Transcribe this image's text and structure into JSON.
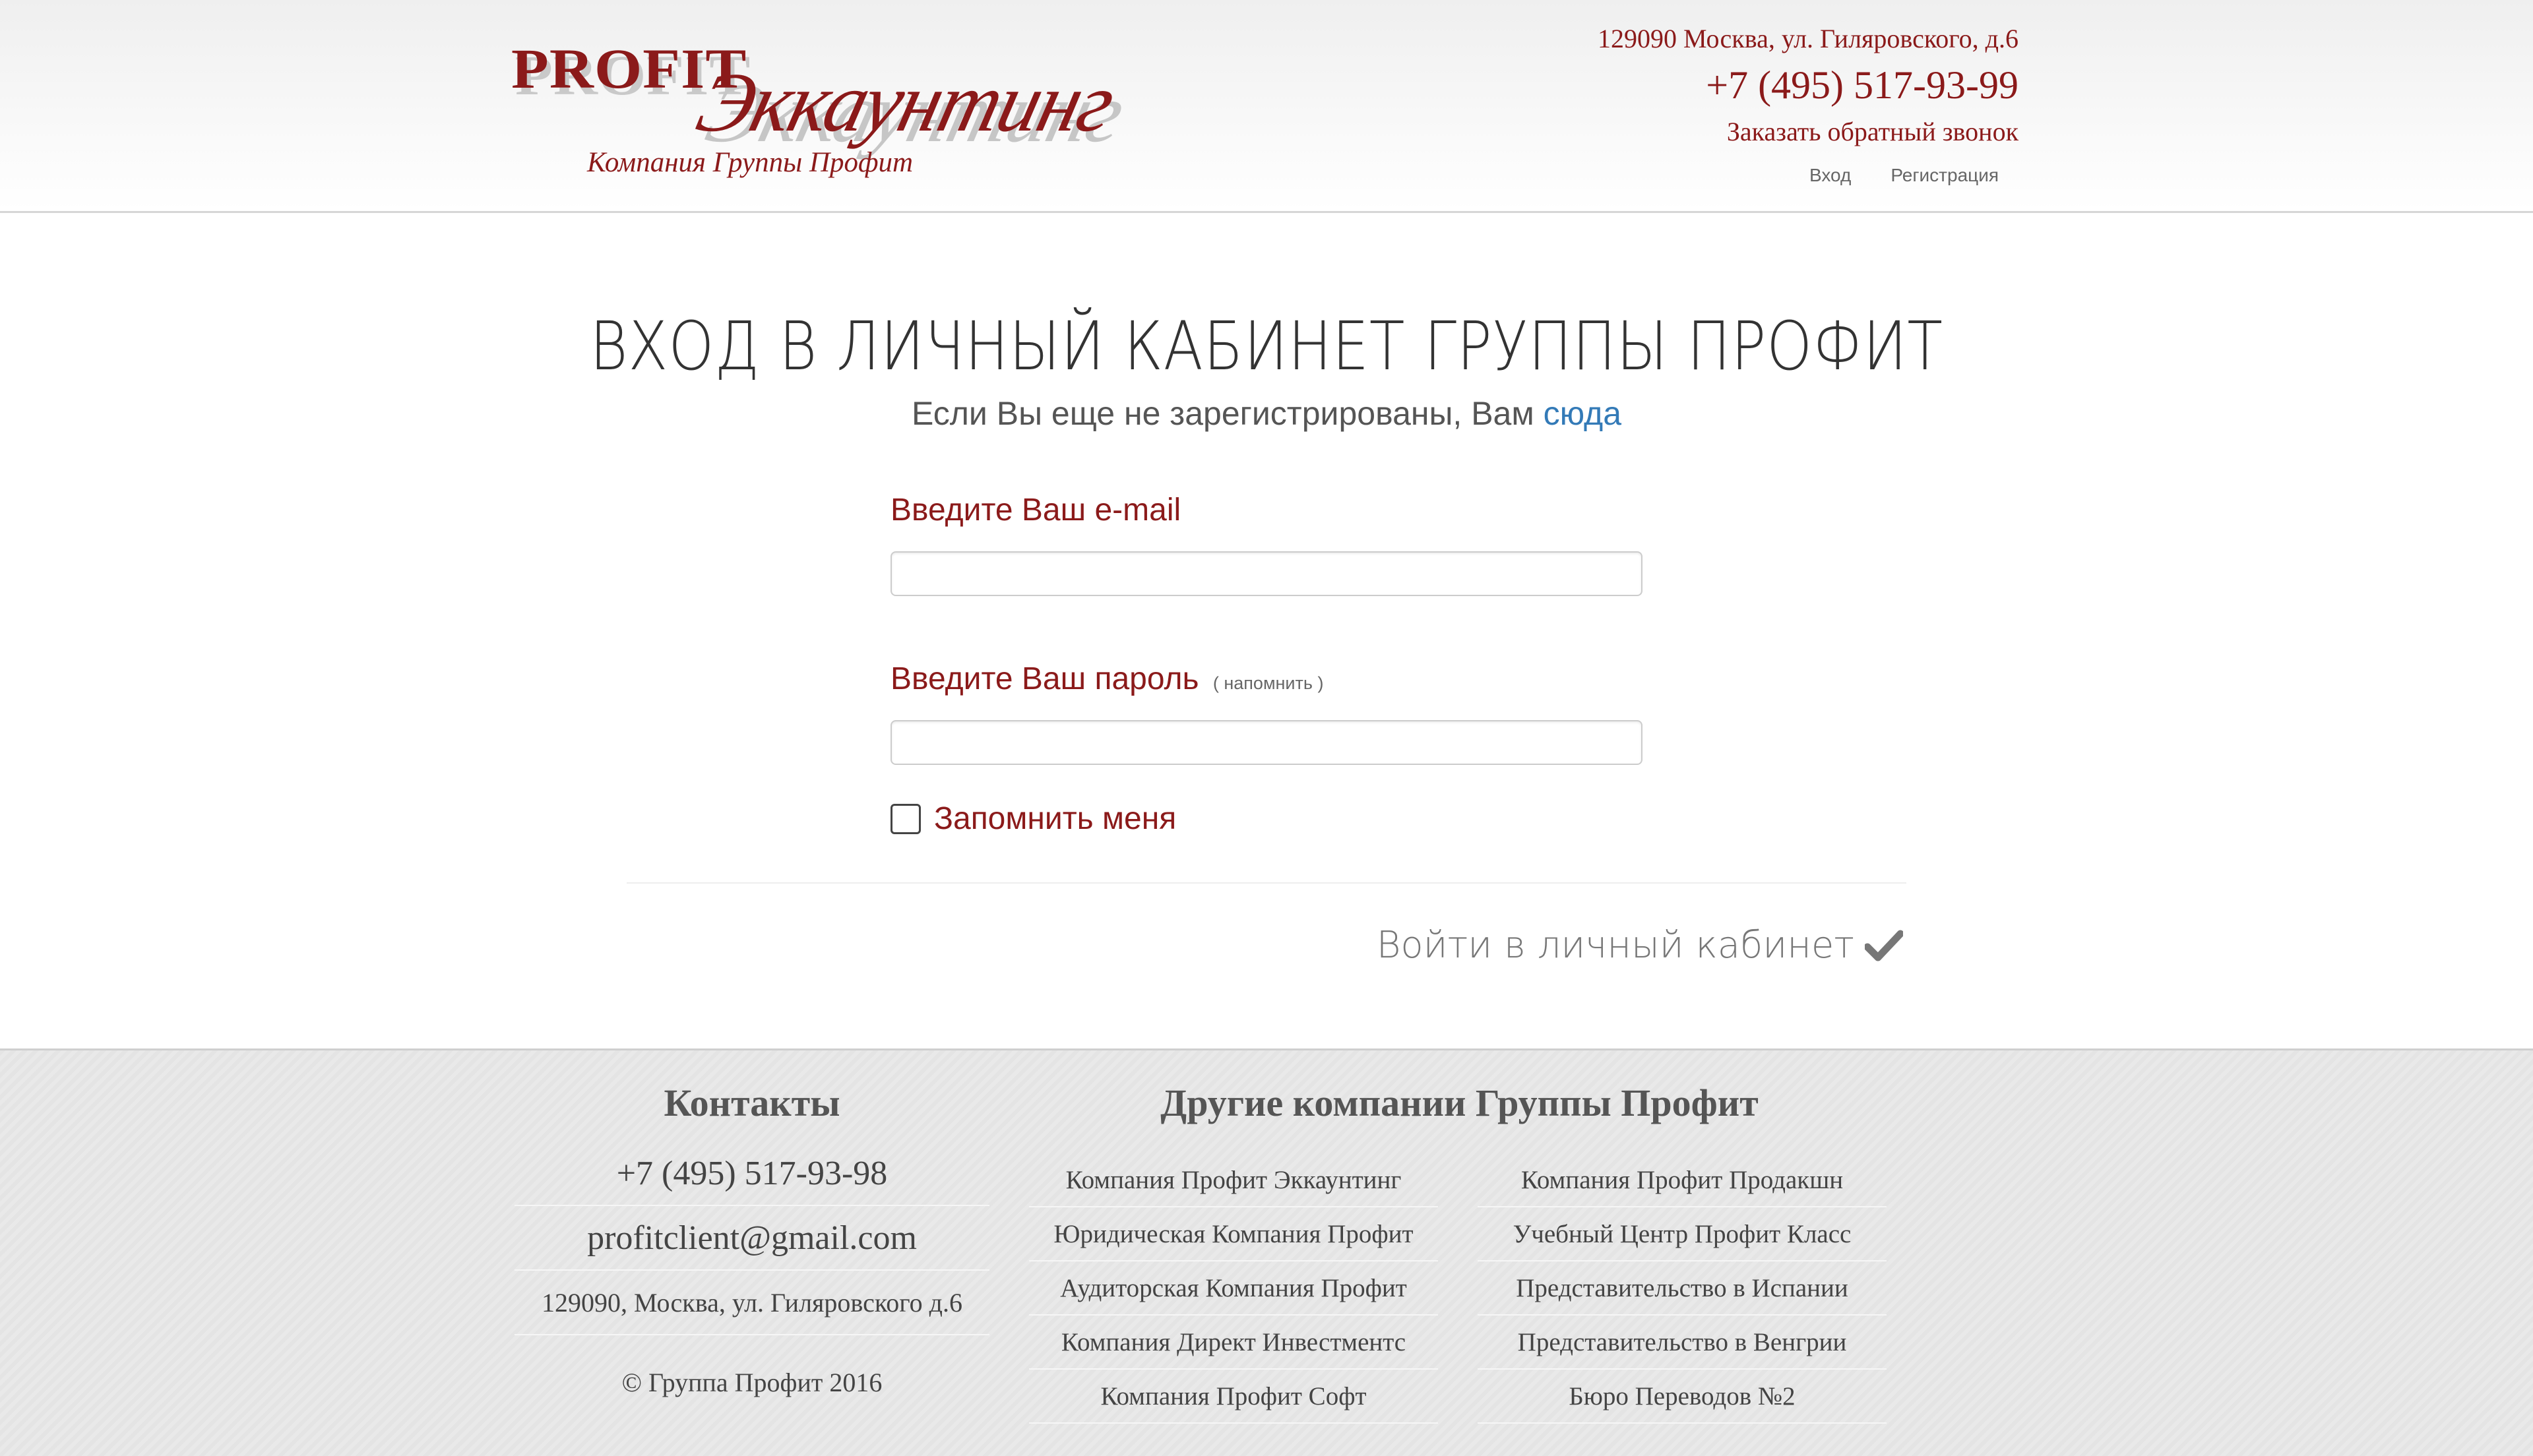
{
  "header": {
    "logo_word": "PROFIT",
    "logo_script": "Эккаунтинг",
    "logo_tagline": "Компания Группы Профит",
    "address": "129090 Москва, ул. Гиляровского, д.6",
    "phone": "+7 (495) 517-93-99",
    "callback_label": "Заказать обратный звонок",
    "nav": {
      "login": "Вход",
      "register": "Регистрация"
    }
  },
  "main": {
    "title": "ВХОД В ЛИЧНЫЙ КАБИНЕТ ГРУППЫ ПРОФИТ",
    "subtitle_text": "Если Вы еще не зарегистрированы, Вам",
    "subtitle_link": "сюда",
    "email_label": "Введите Ваш e-mail",
    "email_value": "",
    "password_label": "Введите Ваш пароль",
    "password_hint_open": "(",
    "password_hint_link": "напомнить",
    "password_hint_close": ")",
    "password_value": "",
    "remember_label": "Запомнить меня",
    "remember_checked": false,
    "submit_label": "Войти в личный кабинет"
  },
  "footer": {
    "contacts_heading": "Контакты",
    "contacts": {
      "phone": "+7 (495) 517-93-98",
      "email": "profitclient@gmail.com",
      "address": "129090, Москва, ул. Гиляровского д.6"
    },
    "copyright": "© Группа Профит 2016",
    "companies_heading": "Другие компании Группы Профит",
    "companies_left": [
      "Компания Профит Эккаунтинг",
      "Юридическая Компания Профит",
      "Аудиторская Компания Профит",
      "Компания Директ Инвестментс",
      "Компания Профит Софт"
    ],
    "companies_right": [
      "Компания Профит Продакшн",
      "Учебный Центр Профит Класс",
      "Представительство в Испании",
      "Представительство в Венгрии",
      "Бюро Переводов №2"
    ]
  },
  "colors": {
    "brand": "#8b1a1a",
    "link": "#337ab7",
    "text_muted": "#777777"
  },
  "icons": {
    "submit": "check-icon"
  }
}
